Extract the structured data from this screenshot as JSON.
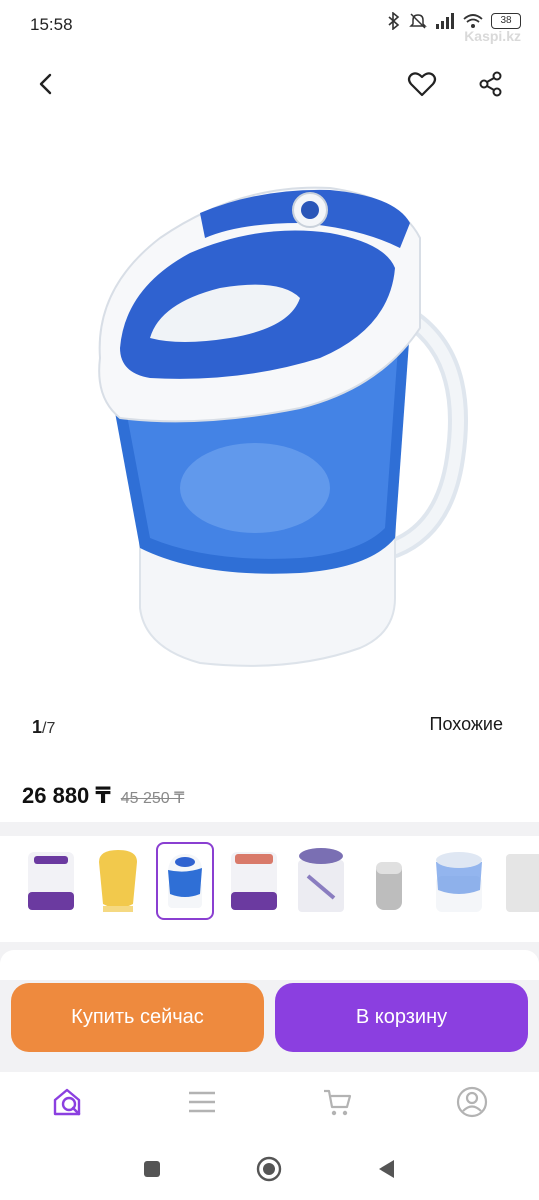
{
  "status": {
    "time": "15:58",
    "battery": "38",
    "watermark": "Kaspi.kz"
  },
  "nav": {
    "back_icon": "chevron-left-icon",
    "favorite_icon": "heart-icon",
    "share_icon": "share-icon"
  },
  "gallery": {
    "current": "1",
    "separator": "/",
    "total": "7",
    "similar_label": "Похожие"
  },
  "product": {
    "price": "26 880 ₸",
    "old_price": "45 250 ₸"
  },
  "thumbnails": [
    {
      "color": "#6b3aa0",
      "selected": false
    },
    {
      "color": "#f2c94c",
      "selected": false
    },
    {
      "color": "#2f6fd6",
      "selected": true
    },
    {
      "color": "#6b3aa0",
      "selected": false
    },
    {
      "color": "#7a6fb3",
      "selected": false
    },
    {
      "color": "#bdbdbd",
      "selected": false
    },
    {
      "color": "#3a78e0",
      "selected": false
    },
    {
      "color": "#e5e5e5",
      "selected": false
    }
  ],
  "actions": {
    "buy_now": "Купить сейчас",
    "add_to_cart": "В корзину"
  },
  "tabs": [
    {
      "icon": "home-search-icon",
      "active": true
    },
    {
      "icon": "menu-icon",
      "active": false
    },
    {
      "icon": "cart-icon",
      "active": false
    },
    {
      "icon": "profile-icon",
      "active": false
    }
  ],
  "colors": {
    "accent_purple": "#8b3fe0",
    "accent_orange": "#ee8a3e"
  }
}
